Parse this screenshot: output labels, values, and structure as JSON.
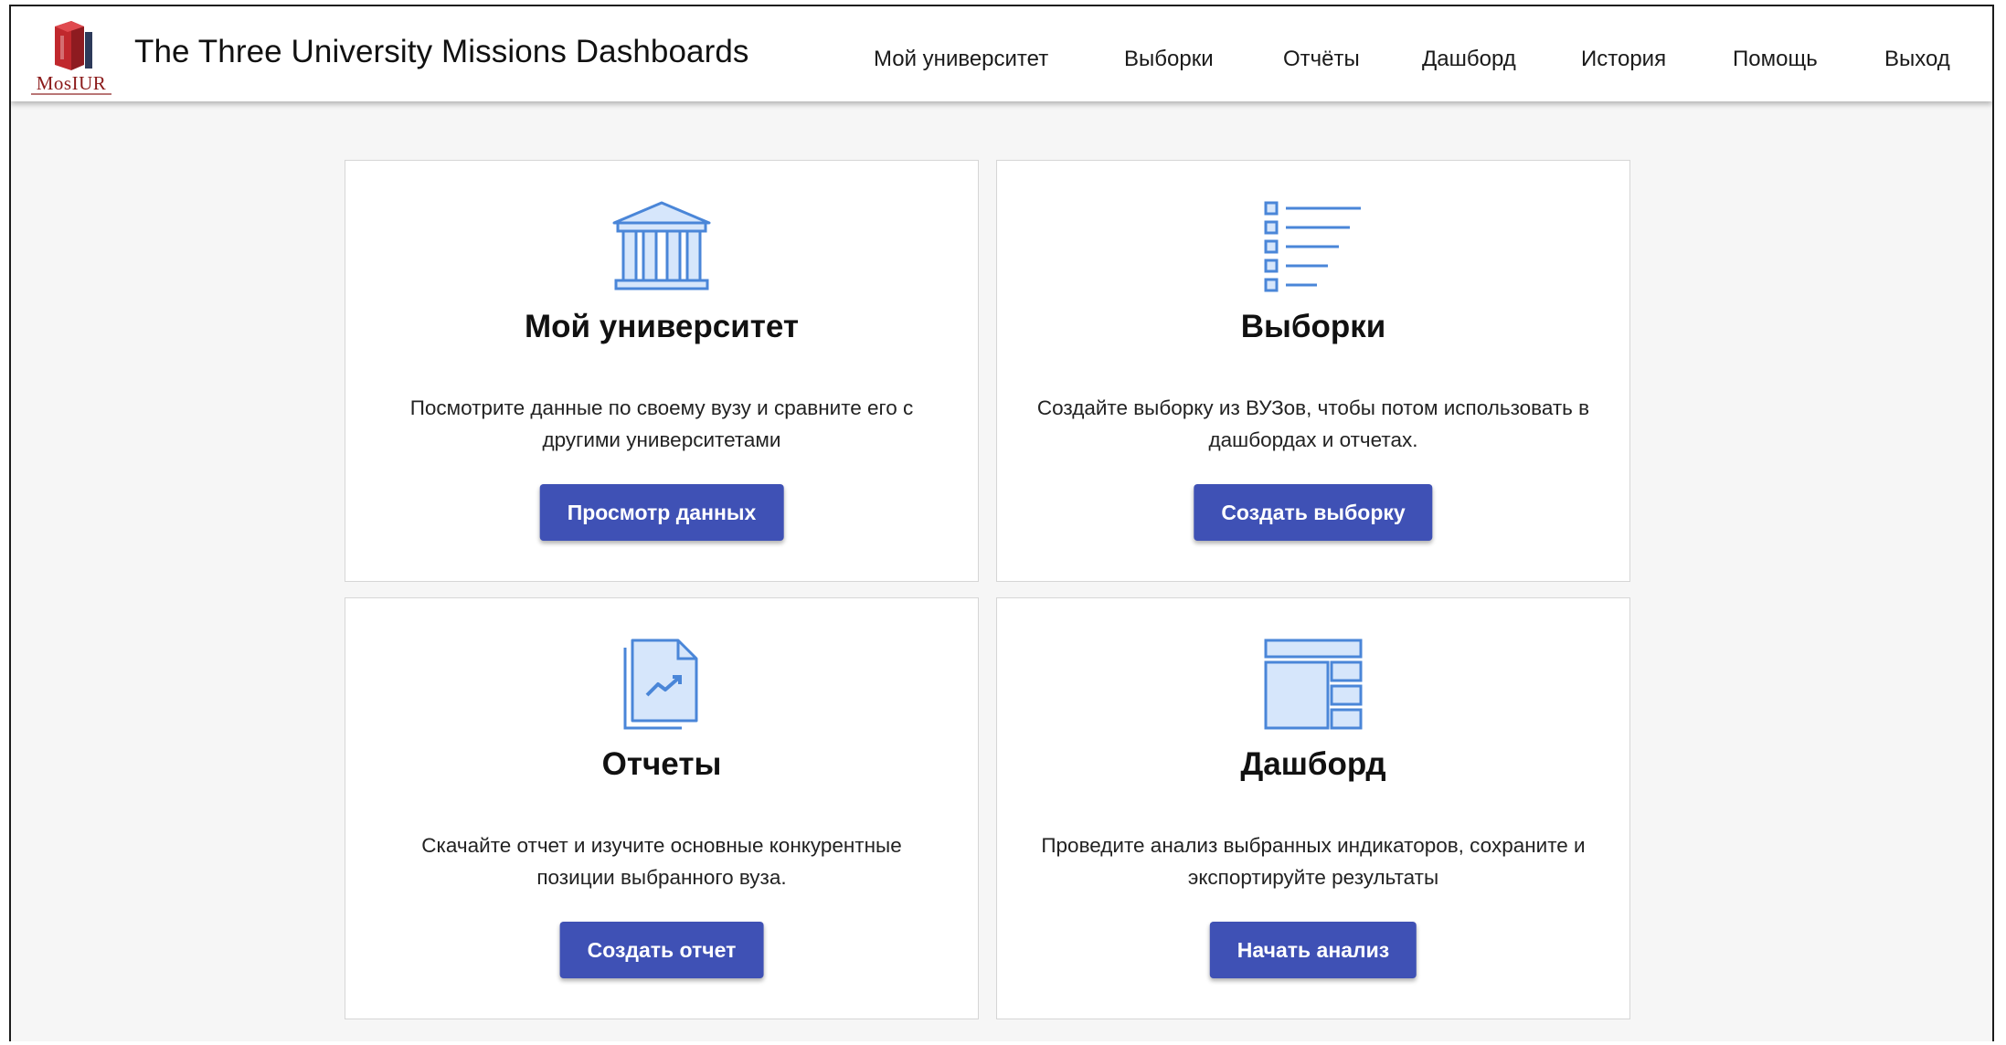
{
  "header": {
    "logo_text": "MosIUR",
    "title": "The Three University Missions Dashboards"
  },
  "nav": {
    "items": [
      {
        "label": "Мой университет"
      },
      {
        "label": "Выборки"
      },
      {
        "label": "Отчёты"
      },
      {
        "label": "Дашборд"
      },
      {
        "label": "История"
      },
      {
        "label": "Помощь"
      },
      {
        "label": "Выход"
      }
    ]
  },
  "cards": [
    {
      "icon": "university-building-icon",
      "title": "Мой университет",
      "text": "Посмотрите данные по своему вузу и сравните его с другими университетами",
      "button": "Просмотр данных"
    },
    {
      "icon": "list-icon",
      "title": "Выборки",
      "text": "Создайте выборку из ВУЗов, чтобы потом использовать в дашбордах и отчетах.",
      "button": "Создать выборку"
    },
    {
      "icon": "report-document-icon",
      "title": "Отчеты",
      "text": "Скачайте отчет и изучите основные конкурентные позиции выбранного вуза.",
      "button": "Создать отчет"
    },
    {
      "icon": "dashboard-layout-icon",
      "title": "Дашборд",
      "text": "Проведите анализ выбранных индикаторов, сохраните и экспортируйте результаты",
      "button": "Начать анализ"
    }
  ],
  "colors": {
    "accent": "#3f51b5",
    "icon_fill": "#d6e6fb",
    "icon_stroke": "#4a86d8",
    "logo_red": "#c0282d"
  }
}
